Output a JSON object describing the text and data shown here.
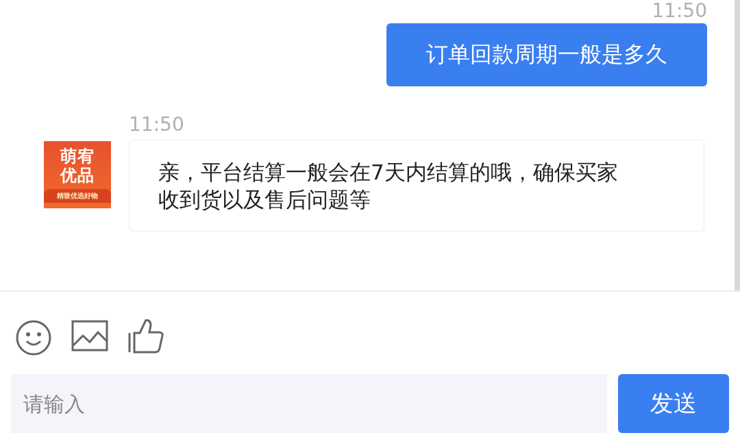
{
  "messages": [
    {
      "kind": "sent",
      "time": "11:50",
      "text": "订单回款周期一般是多久"
    },
    {
      "kind": "received",
      "time": "11:50",
      "avatar": {
        "line1": "萌宥",
        "line2": "优品",
        "slogan": "精致优选好物"
      },
      "text": "亲，平台结算一般会在7天内结算的哦，确保买家收到货以及售后问题等"
    }
  ],
  "composer": {
    "placeholder": "请输入",
    "send": "发送"
  }
}
